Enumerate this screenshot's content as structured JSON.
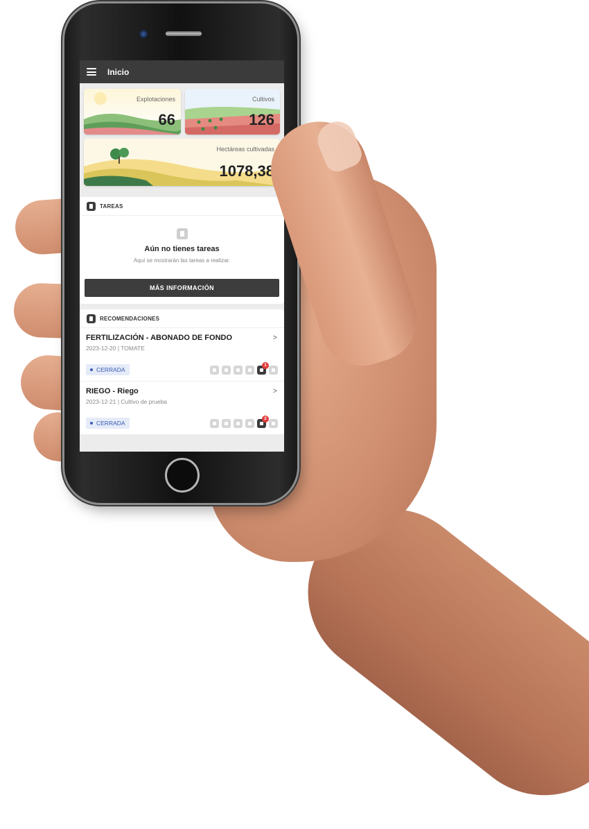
{
  "app": {
    "title": "Inicio"
  },
  "stats": {
    "explotaciones": {
      "label": "Explotaciones",
      "value": "66"
    },
    "cultivos": {
      "label": "Cultivos",
      "value": "126"
    },
    "hectareas": {
      "label": "Hectáreas cultivadas",
      "value": "1078,38"
    }
  },
  "tasks": {
    "header": "TAREAS",
    "empty_title": "Aún no tienes tareas",
    "empty_subtitle": "Aquí se mostrarán las tareas a realizar.",
    "button_label": "MÁS INFORMACIÓN"
  },
  "recommendations": {
    "header": "RECOMENDACIONES",
    "items": [
      {
        "title": "FERTILIZACIÓN - ABONADO DE FONDO",
        "subtitle": "2023-12-20 | TOMATE",
        "status": "CERRADA",
        "badge": "1"
      },
      {
        "title": "RIEGO - Riego",
        "subtitle": "2023-12-21 | Cultivo de prueba",
        "status": "CERRADA",
        "badge": "2"
      }
    ]
  },
  "colors": {
    "appbar": "#3b3b3b",
    "status_chip_bg": "#e5ebf8",
    "status_chip_text": "#3b5bb5",
    "badge": "#e23b3b"
  }
}
